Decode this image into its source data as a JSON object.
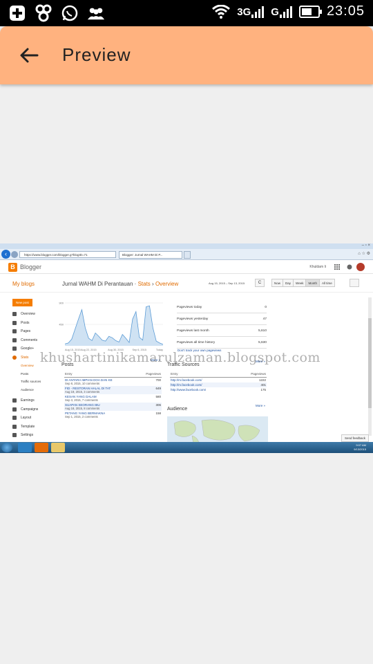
{
  "status_bar": {
    "network_left": "3G",
    "network_right": "G",
    "time": "23:05"
  },
  "app_bar": {
    "title": "Preview",
    "back_icon": "arrow-left-icon"
  },
  "screenshot": {
    "browser": {
      "address": "https://www.blogger.com/blogger.g?blogID=71",
      "tab_title": "Blogger: Jurnal WAHM Di P...",
      "window_controls": "– ▫ ×"
    },
    "blogger": {
      "logo": "B",
      "brand": "Blogger",
      "user": "Khuldam Ii"
    },
    "subheader": {
      "my_blogs": "My blogs",
      "blog_title": "Jurnal WAHM Di Perantauan",
      "sep1": "·",
      "stats": "Stats",
      "sep2": "›",
      "overview": "Overview",
      "date_range": "Aug 15, 2015 – Sep 13, 2015",
      "refresh": "C",
      "range_buttons": [
        "Now",
        "Day",
        "Week",
        "Month",
        "All time"
      ],
      "active_range": "Month"
    },
    "sidebar": {
      "new_post": "New post",
      "items": [
        {
          "label": "Overview",
          "icon": "home-icon"
        },
        {
          "label": "Posts",
          "icon": "posts-icon"
        },
        {
          "label": "Pages",
          "icon": "pages-icon"
        },
        {
          "label": "Comments",
          "icon": "comments-icon"
        },
        {
          "label": "Google+",
          "icon": "google-plus-icon"
        },
        {
          "label": "Stats",
          "icon": "stats-icon"
        }
      ],
      "stats_sub": [
        "Overview",
        "Posts",
        "Traffic sources",
        "Audience"
      ],
      "items2": [
        {
          "label": "Earnings",
          "icon": "trophy-icon"
        },
        {
          "label": "Campaigns",
          "icon": "campaigns-icon"
        },
        {
          "label": "Layout",
          "icon": "layout-icon"
        },
        {
          "label": "Template",
          "icon": "template-icon"
        },
        {
          "label": "Settings",
          "icon": "wrench-icon"
        }
      ]
    },
    "chart": {
      "y_ticks": [
        "900",
        "450"
      ],
      "x_ticks": [
        "Aug 15, 2015",
        "Aug 22, 2015",
        "Aug 30, 2015",
        "Sep 6, 2015",
        "Today"
      ],
      "more": "More »"
    },
    "pageviews": [
      {
        "label": "Pageviews today",
        "value": "0"
      },
      {
        "label": "Pageviews yesterday",
        "value": "47"
      },
      {
        "label": "Pageviews last month",
        "value": "5,610"
      },
      {
        "label": "Pageviews all time history",
        "value": "5,630"
      }
    ],
    "track_link": "Don't track your own pageviews",
    "track_more": "More »",
    "posts": {
      "title": "Posts",
      "col_entry": "Entry",
      "col_pageviews": "Pageviews",
      "rows": [
        {
          "title": "DI ANTARA IMPIAN DOA DAN KE",
          "meta": "Sep 8, 2015, 10 comments",
          "value": "700"
        },
        {
          "title": "FID - RESTORAN HALAL DI TAT",
          "meta": "Aug 19, 2015, 3 comments",
          "value": "649"
        },
        {
          "title": "KESAN YANG DALAM",
          "meta": "Sep 3, 2015, 7 comments",
          "value": "580"
        },
        {
          "title": "SUAPAN SEORANG IBU",
          "meta": "Aug 18, 2015, 8 comments",
          "value": "306"
        },
        {
          "title": "PETANG YANG BERMAKNA",
          "meta": "Sep 1, 2015, 2 comments",
          "value": "158"
        }
      ]
    },
    "traffic": {
      "title": "Traffic Sources",
      "col_entry": "Entry",
      "col_pageviews": "Pageviews",
      "rows": [
        {
          "url": "http://m.facebook.com/",
          "value": "1222"
        },
        {
          "url": "http://m.facebook.com/",
          "value": "401"
        },
        {
          "url": "http://www.facebook.com/",
          "value": "175"
        }
      ],
      "more": "More »"
    },
    "audience": {
      "title": "Audience"
    },
    "send_feedback": "Send feedback",
    "taskbar": {
      "clock_time": "9:07 AM",
      "clock_date": "9/13/2015"
    }
  },
  "watermark": "khushartinikamarulzaman.blogspot.com",
  "chart_data": {
    "type": "area",
    "x": [
      "Aug 15",
      "Aug 16",
      "Aug 17",
      "Aug 18",
      "Aug 19",
      "Aug 20",
      "Aug 21",
      "Aug 22",
      "Aug 23",
      "Aug 24",
      "Aug 25",
      "Aug 26",
      "Aug 27",
      "Aug 28",
      "Aug 29",
      "Aug 30",
      "Aug 31",
      "Sep 1",
      "Sep 2",
      "Sep 3",
      "Sep 4",
      "Sep 5",
      "Sep 6",
      "Sep 7",
      "Sep 8",
      "Sep 9",
      "Sep 10",
      "Sep 11",
      "Sep 12",
      "Sep 13"
    ],
    "values": [
      40,
      60,
      140,
      350,
      560,
      760,
      380,
      160,
      110,
      270,
      200,
      120,
      100,
      200,
      170,
      110,
      80,
      240,
      160,
      70,
      560,
      720,
      180,
      120,
      820,
      840,
      380,
      100,
      60,
      30
    ],
    "ylim": [
      0,
      900
    ],
    "y_ticks": [
      450,
      900
    ],
    "x_tick_labels": [
      "Aug 15, 2015",
      "Aug 22, 2015",
      "Aug 30, 2015",
      "Sep 6, 2015",
      "Today"
    ],
    "color": "#5b9bd5",
    "fill": "#cfe2f3"
  }
}
